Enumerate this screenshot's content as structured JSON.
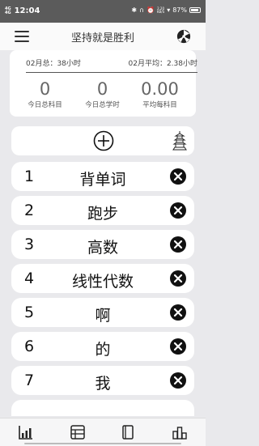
{
  "status_bar": {
    "network": "4G",
    "network_sub": "4G",
    "time": "12:04",
    "speed_top": "2.20",
    "speed_bottom": "KB/S",
    "battery_text": "87%",
    "battery_level": 0.87
  },
  "app_bar": {
    "title": "坚持就是胜利",
    "menu_icon": "hamburger-menu-icon",
    "right_icon": "theme-palette-icon"
  },
  "summary": {
    "month_total_label": "02月总：38小时",
    "month_avg_label": "02月平均：2.38小时",
    "stats": [
      {
        "value": "0",
        "label": "今日总科目"
      },
      {
        "value": "0",
        "label": "今日总学时"
      },
      {
        "value": "0.00",
        "label": "平均每科目"
      }
    ]
  },
  "toolbar": {
    "add_icon": "plus-circle-icon",
    "tower_icon": "pagoda-icon"
  },
  "subjects": [
    {
      "index": "1",
      "name": "背单词"
    },
    {
      "index": "2",
      "name": "跑步"
    },
    {
      "index": "3",
      "name": "高数"
    },
    {
      "index": "4",
      "name": "线性代数"
    },
    {
      "index": "5",
      "name": "啊"
    },
    {
      "index": "6",
      "name": "的"
    },
    {
      "index": "7",
      "name": "我"
    }
  ],
  "bottom_nav": [
    "chart-bar-icon",
    "table-icon",
    "book-icon",
    "ranking-icon"
  ]
}
